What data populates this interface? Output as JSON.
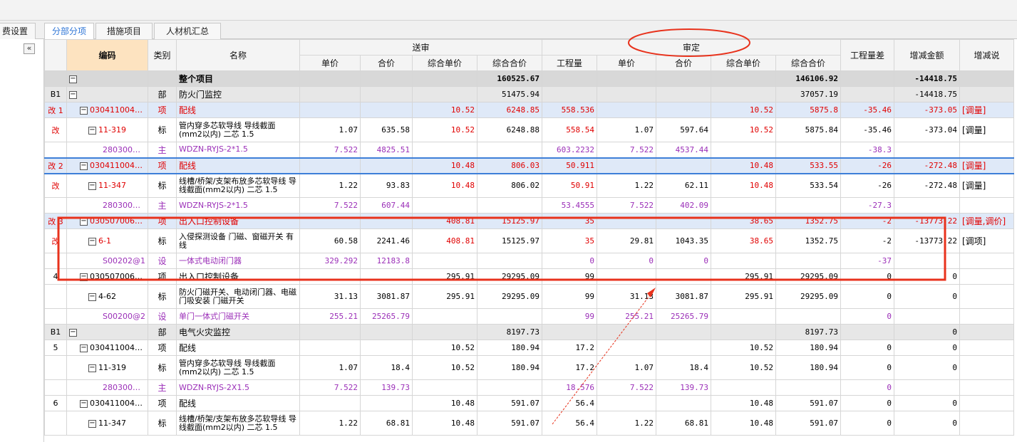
{
  "menu": [
    "费设置",
    "分部分项",
    "措施项目",
    "人材机汇总"
  ],
  "tabs": [
    "费设置",
    "分部分项",
    "措施项目",
    "人材机汇总"
  ],
  "top_menu_fragment": "...",
  "collapse_label": "«",
  "header": {
    "code": "编码",
    "cat": "类别",
    "name": "名称",
    "group_send": "送审",
    "group_audit": "审定",
    "send_unit": "单价",
    "send_total": "合价",
    "send_cunit": "综合单价",
    "send_ctotal": "综合合价",
    "audit_qty": "工程量",
    "audit_unit": "单价",
    "audit_total": "合价",
    "audit_cunit": "综合单价",
    "audit_ctotal": "综合合价",
    "qty_diff": "工程量差",
    "amount_diff": "增减金额",
    "remark": "增减说"
  },
  "rows": [
    {
      "k": "total",
      "c0": "",
      "code": "",
      "cat": "",
      "name": "整个项目",
      "v": [
        "",
        "",
        "",
        "160525.67",
        "",
        "",
        "",
        "",
        "146106.92",
        "",
        "-14418.75",
        ""
      ]
    },
    {
      "k": "bu",
      "c0": "B1",
      "code": "",
      "cat": "部",
      "name": "防火门监控",
      "v": [
        "",
        "",
        "",
        "51475.94",
        "",
        "",
        "",
        "",
        "37057.19",
        "",
        "-14418.75",
        ""
      ]
    },
    {
      "k": "item",
      "c0": "改 1",
      "code": "030411004…",
      "cat": "项",
      "name": "配线",
      "v": [
        "",
        "",
        "10.52",
        "6248.85",
        "558.536",
        "",
        "",
        "10.52",
        "5875.8",
        "-35.46",
        "-373.05",
        "[调量]"
      ]
    },
    {
      "k": "sub",
      "c0": "改",
      "code": "11-319",
      "cat": "标",
      "name": "管内穿多芯软导线 导线截面(mm2以内) 二芯 1.5",
      "v": [
        "1.07",
        "635.58",
        "10.52",
        "6248.88",
        "558.54",
        "1.07",
        "597.64",
        "10.52",
        "5875.84",
        "-35.46",
        "-373.04",
        "[调量]"
      ]
    },
    {
      "k": "mat",
      "c0": "",
      "code": "280300…",
      "cat": "主",
      "name": "WDZN-RYJS-2*1.5",
      "v": [
        "7.522",
        "4825.51",
        "",
        "",
        "603.2232",
        "7.522",
        "4537.44",
        "",
        "",
        "-38.3",
        "",
        ""
      ]
    },
    {
      "k": "sel",
      "c0": "改 2",
      "code": "030411004…",
      "cat": "项",
      "name": "配线",
      "v": [
        "",
        "",
        "10.48",
        "806.03",
        "50.911",
        "",
        "",
        "10.48",
        "533.55",
        "-26",
        "-272.48",
        "[调量]"
      ]
    },
    {
      "k": "sub",
      "c0": "改",
      "code": "11-347",
      "cat": "标",
      "name": "线槽/桥架/支架布放多芯软导线 导线截面(mm2以内) 二芯 1.5",
      "v": [
        "1.22",
        "93.83",
        "10.48",
        "806.02",
        "50.91",
        "1.22",
        "62.11",
        "10.48",
        "533.54",
        "-26",
        "-272.48",
        "[调量]"
      ]
    },
    {
      "k": "mat",
      "c0": "",
      "code": "280300…",
      "cat": "主",
      "name": "WDZN-RYJS-2*1.5",
      "v": [
        "7.522",
        "607.44",
        "",
        "",
        "53.4555",
        "7.522",
        "402.09",
        "",
        "",
        "-27.3",
        "",
        ""
      ]
    },
    {
      "k": "item",
      "c0": "改 3",
      "code": "030507006…",
      "cat": "项",
      "name": "出入口控制设备",
      "v": [
        "",
        "",
        "408.81",
        "15125.97",
        "35",
        "",
        "",
        "38.65",
        "1352.75",
        "-2",
        "-13773.22",
        "[调量,调价]"
      ]
    },
    {
      "k": "sub",
      "c0": "改",
      "code": "6-1",
      "cat": "标",
      "name": "入侵探测设备 门磁、窗磁开关 有线",
      "v": [
        "60.58",
        "2241.46",
        "408.81",
        "15125.97",
        "35",
        "29.81",
        "1043.35",
        "38.65",
        "1352.75",
        "-2",
        "-13773.22",
        "[调项]"
      ]
    },
    {
      "k": "mat",
      "c0": "",
      "code": "S00202@1",
      "cat": "设",
      "name": "一体式电动闭门器",
      "v": [
        "329.292",
        "12183.8",
        "",
        "",
        "0",
        "0",
        "0",
        "",
        "",
        "-37",
        "",
        ""
      ]
    },
    {
      "k": "item2",
      "c0": "4",
      "code": "030507006…",
      "cat": "项",
      "name": "出入口控制设备",
      "v": [
        "",
        "",
        "295.91",
        "29295.09",
        "99",
        "",
        "",
        "295.91",
        "29295.09",
        "0",
        "0",
        ""
      ]
    },
    {
      "k": "sub",
      "c0": "",
      "code": "4-62",
      "cat": "标",
      "name": "防火门磁开关、电动闭门器、电磁门吸安装 门磁开关",
      "v": [
        "31.13",
        "3081.87",
        "295.91",
        "29295.09",
        "99",
        "31.13",
        "3081.87",
        "295.91",
        "29295.09",
        "0",
        "0",
        ""
      ]
    },
    {
      "k": "mat",
      "c0": "",
      "code": "S00200@2",
      "cat": "设",
      "name": "单门一体式门磁开关",
      "v": [
        "255.21",
        "25265.79",
        "",
        "",
        "99",
        "255.21",
        "25265.79",
        "",
        "",
        "0",
        "",
        ""
      ]
    },
    {
      "k": "bu",
      "c0": "B1",
      "code": "",
      "cat": "部",
      "name": "电气火灾监控",
      "v": [
        "",
        "",
        "",
        "8197.73",
        "",
        "",
        "",
        "",
        "8197.73",
        "",
        "0",
        ""
      ]
    },
    {
      "k": "item2",
      "c0": "5",
      "code": "030411004…",
      "cat": "项",
      "name": "配线",
      "v": [
        "",
        "",
        "10.52",
        "180.94",
        "17.2",
        "",
        "",
        "10.52",
        "180.94",
        "0",
        "0",
        ""
      ]
    },
    {
      "k": "sub",
      "c0": "",
      "code": "11-319",
      "cat": "标",
      "name": "管内穿多芯软导线 导线截面(mm2以内) 二芯 1.5",
      "v": [
        "1.07",
        "18.4",
        "10.52",
        "180.94",
        "17.2",
        "1.07",
        "18.4",
        "10.52",
        "180.94",
        "0",
        "0",
        ""
      ]
    },
    {
      "k": "mat",
      "c0": "",
      "code": "280300…",
      "cat": "主",
      "name": "WDZN-RYJS-2X1.5",
      "v": [
        "7.522",
        "139.73",
        "",
        "",
        "18.576",
        "7.522",
        "139.73",
        "",
        "",
        "0",
        "",
        ""
      ]
    },
    {
      "k": "item2",
      "c0": "6",
      "code": "030411004…",
      "cat": "项",
      "name": "配线",
      "v": [
        "",
        "",
        "10.48",
        "591.07",
        "56.4",
        "",
        "",
        "10.48",
        "591.07",
        "0",
        "0",
        ""
      ]
    },
    {
      "k": "sub",
      "c0": "",
      "code": "11-347",
      "cat": "标",
      "name": "线槽/桥架/支架布放多芯软导线 导线截面(mm2以内) 二芯 1.5",
      "v": [
        "1.22",
        "68.81",
        "10.48",
        "591.07",
        "56.4",
        "1.22",
        "68.81",
        "10.48",
        "591.07",
        "0",
        "0",
        ""
      ]
    }
  ],
  "colors": {
    "accent": "#2e75d6",
    "red": "#e00000",
    "purple": "#9b2fb8",
    "annotation": "#e8321c"
  }
}
